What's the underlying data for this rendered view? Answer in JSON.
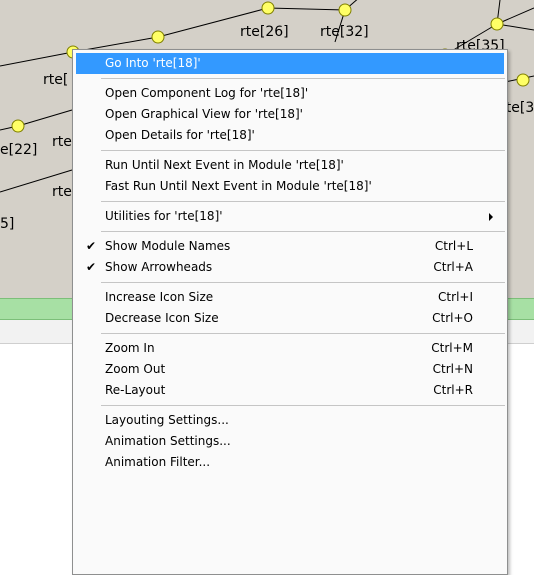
{
  "canvas": {
    "background": "#d4d0c8",
    "node_color": "#ffff66",
    "labels": [
      {
        "text": "rte[26]"
      },
      {
        "text": "rte[32]"
      },
      {
        "text": "rte[35]"
      },
      {
        "text": "rte["
      },
      {
        "text": "rte[3"
      },
      {
        "text": "rte"
      },
      {
        "text": "e[22]"
      },
      {
        "text": "rte"
      },
      {
        "text": "5]"
      }
    ]
  },
  "status_bar": {
    "color": "#a7e0a4"
  },
  "context_menu": {
    "groups": [
      [
        {
          "label": "Go Into 'rte[18]'",
          "highlighted": true
        }
      ],
      [
        {
          "label": "Open Component Log for 'rte[18]'"
        },
        {
          "label": "Open Graphical View for 'rte[18]'"
        },
        {
          "label": "Open Details for 'rte[18]'"
        }
      ],
      [
        {
          "label": "Run Until Next Event in Module 'rte[18]'"
        },
        {
          "label": "Fast Run Until Next Event in Module 'rte[18]'"
        }
      ],
      [
        {
          "label": "Utilities for 'rte[18]'",
          "submenu": true
        }
      ],
      [
        {
          "label": "Show Module Names",
          "checked": true,
          "shortcut": "Ctrl+L"
        },
        {
          "label": "Show Arrowheads",
          "checked": true,
          "shortcut": "Ctrl+A"
        }
      ],
      [
        {
          "label": "Increase Icon Size",
          "shortcut": "Ctrl+I"
        },
        {
          "label": "Decrease Icon Size",
          "shortcut": "Ctrl+O"
        }
      ],
      [
        {
          "label": "Zoom In",
          "shortcut": "Ctrl+M"
        },
        {
          "label": "Zoom Out",
          "shortcut": "Ctrl+N"
        },
        {
          "label": "Re-Layout",
          "shortcut": "Ctrl+R"
        }
      ],
      [
        {
          "label": "Layouting Settings..."
        },
        {
          "label": "Animation Settings..."
        },
        {
          "label": "Animation Filter..."
        }
      ]
    ],
    "highlight_color": "#3399ff",
    "check_glyph": "✔"
  }
}
